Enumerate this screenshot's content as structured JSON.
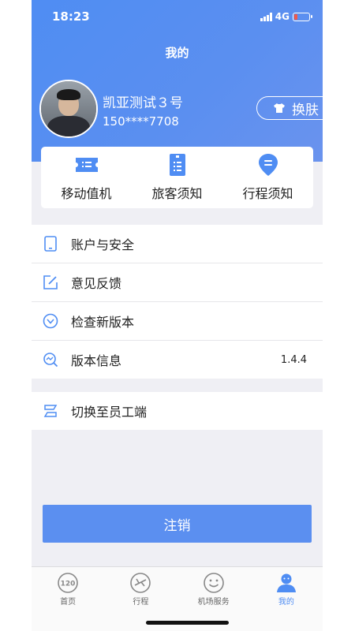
{
  "status_bar": {
    "time": "18:23",
    "network": "4G"
  },
  "header": {
    "title": "我的"
  },
  "profile": {
    "name": "凯亚测试３号",
    "phone": "150****7708"
  },
  "skin_button": {
    "label": "换肤"
  },
  "quick_actions": [
    {
      "label": "移动值机",
      "icon": "boarding-pass-icon"
    },
    {
      "label": "旅客须知",
      "icon": "document-icon"
    },
    {
      "label": "行程须知",
      "icon": "location-pin-icon"
    }
  ],
  "menu": {
    "account_security": "账户与安全",
    "feedback": "意见反馈",
    "check_version": "检查新版本",
    "version_info": "版本信息",
    "version_value": "1.4.4",
    "switch_staff": "切换至员工端"
  },
  "logout": {
    "label": "注销"
  },
  "tabbar": [
    {
      "label": "首页",
      "icon": "home-120-icon"
    },
    {
      "label": "行程",
      "icon": "plane-icon"
    },
    {
      "label": "机场服务",
      "icon": "smile-icon"
    },
    {
      "label": "我的",
      "icon": "profile-icon",
      "active": true
    }
  ],
  "colors": {
    "primary": "#4f8df3",
    "background": "#efeff4"
  }
}
